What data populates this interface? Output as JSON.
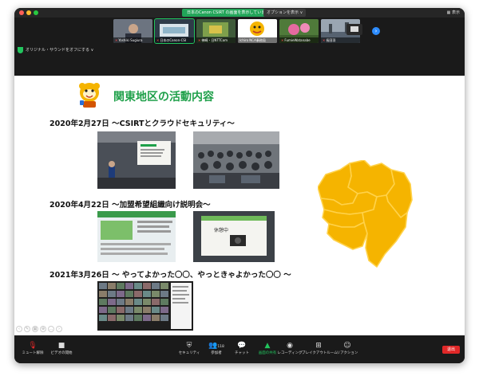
{
  "window": {
    "share_banner": "日本のCanon CSIRT の画面を表示しています",
    "options_label": "オプションを表示 ∨",
    "view_label": "表示"
  },
  "participants": [
    {
      "name": "Yoshiki Sugiura",
      "muted": true
    },
    {
      "name": "日本のCanon-CSI",
      "muted": true
    },
    {
      "name": "神崎・日NTTCom",
      "muted": true
    },
    {
      "name": "Ichiro NCA事務局",
      "muted": false
    },
    {
      "name": "FumieWatanabe",
      "muted": true
    },
    {
      "name": "長田羽",
      "muted": true
    }
  ],
  "audio": {
    "label": "オリジナル・サウンドをオフにする ∨"
  },
  "slide": {
    "title": "関東地区の活動内容",
    "events": [
      {
        "title": "2020年2月27日 〜CSIRTとクラウドセキュリティ〜"
      },
      {
        "title": "2020年4月22日 〜加盟希望組織向け説明会〜"
      },
      {
        "title": "2021年3月26日 〜 やってよかった〇〇、やっときゃよかった〇〇 〜"
      }
    ],
    "photo_label": "休憩中"
  },
  "toolbar": {
    "mute": "ミュート解除",
    "video": "ビデオの開始",
    "security": "セキュリティ",
    "participants": "参加者",
    "participants_count": "118",
    "chat": "チャット",
    "share": "画面の共有",
    "record": "レコーディング",
    "breakout": "ブレイクアウトルーム",
    "reactions": "リアクション",
    "end": "退出"
  },
  "colors": {
    "title_green": "#1fa04a",
    "map_fill": "#f5b400",
    "map_stroke": "#ffd24a",
    "toolbar_bg": "#1a1a1a",
    "end_red": "#e02828"
  }
}
